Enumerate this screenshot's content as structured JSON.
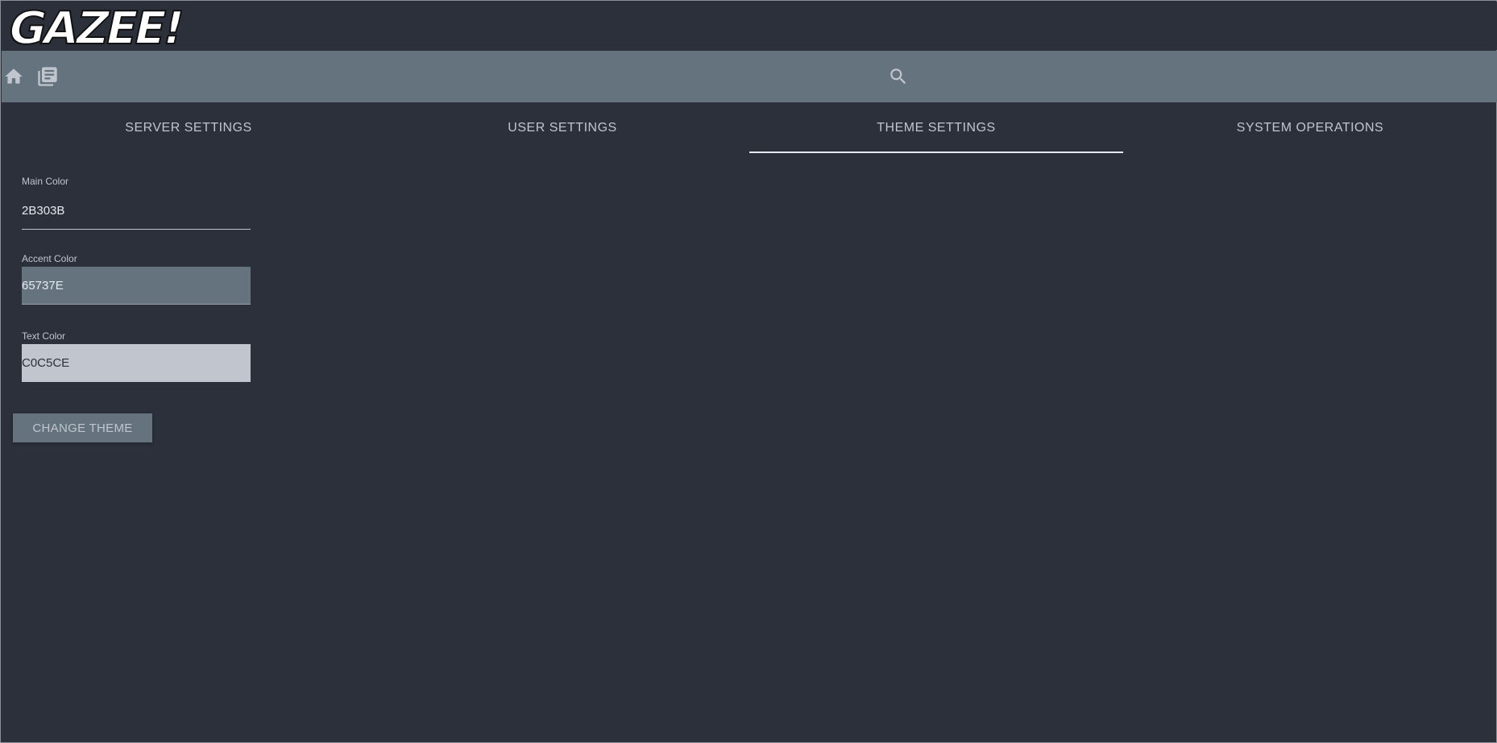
{
  "app": {
    "logo_text": "GAZEE!"
  },
  "toolbar": {
    "home_icon": "home-icon",
    "library_icon": "library-icon",
    "search_icon": "search-icon"
  },
  "tabs": [
    {
      "label": "SERVER SETTINGS",
      "active": false
    },
    {
      "label": "USER SETTINGS",
      "active": false
    },
    {
      "label": "THEME SETTINGS",
      "active": true
    },
    {
      "label": "SYSTEM OPERATIONS",
      "active": false
    }
  ],
  "theme_form": {
    "main_color": {
      "label": "Main Color",
      "value": "2B303B"
    },
    "accent_color": {
      "label": "Accent Color",
      "value": "65737E"
    },
    "text_color": {
      "label": "Text Color",
      "value": "C0C5CE"
    },
    "submit_label": "CHANGE THEME"
  },
  "colors": {
    "main": "#2B303B",
    "accent": "#65737E",
    "text": "#C0C5CE"
  }
}
